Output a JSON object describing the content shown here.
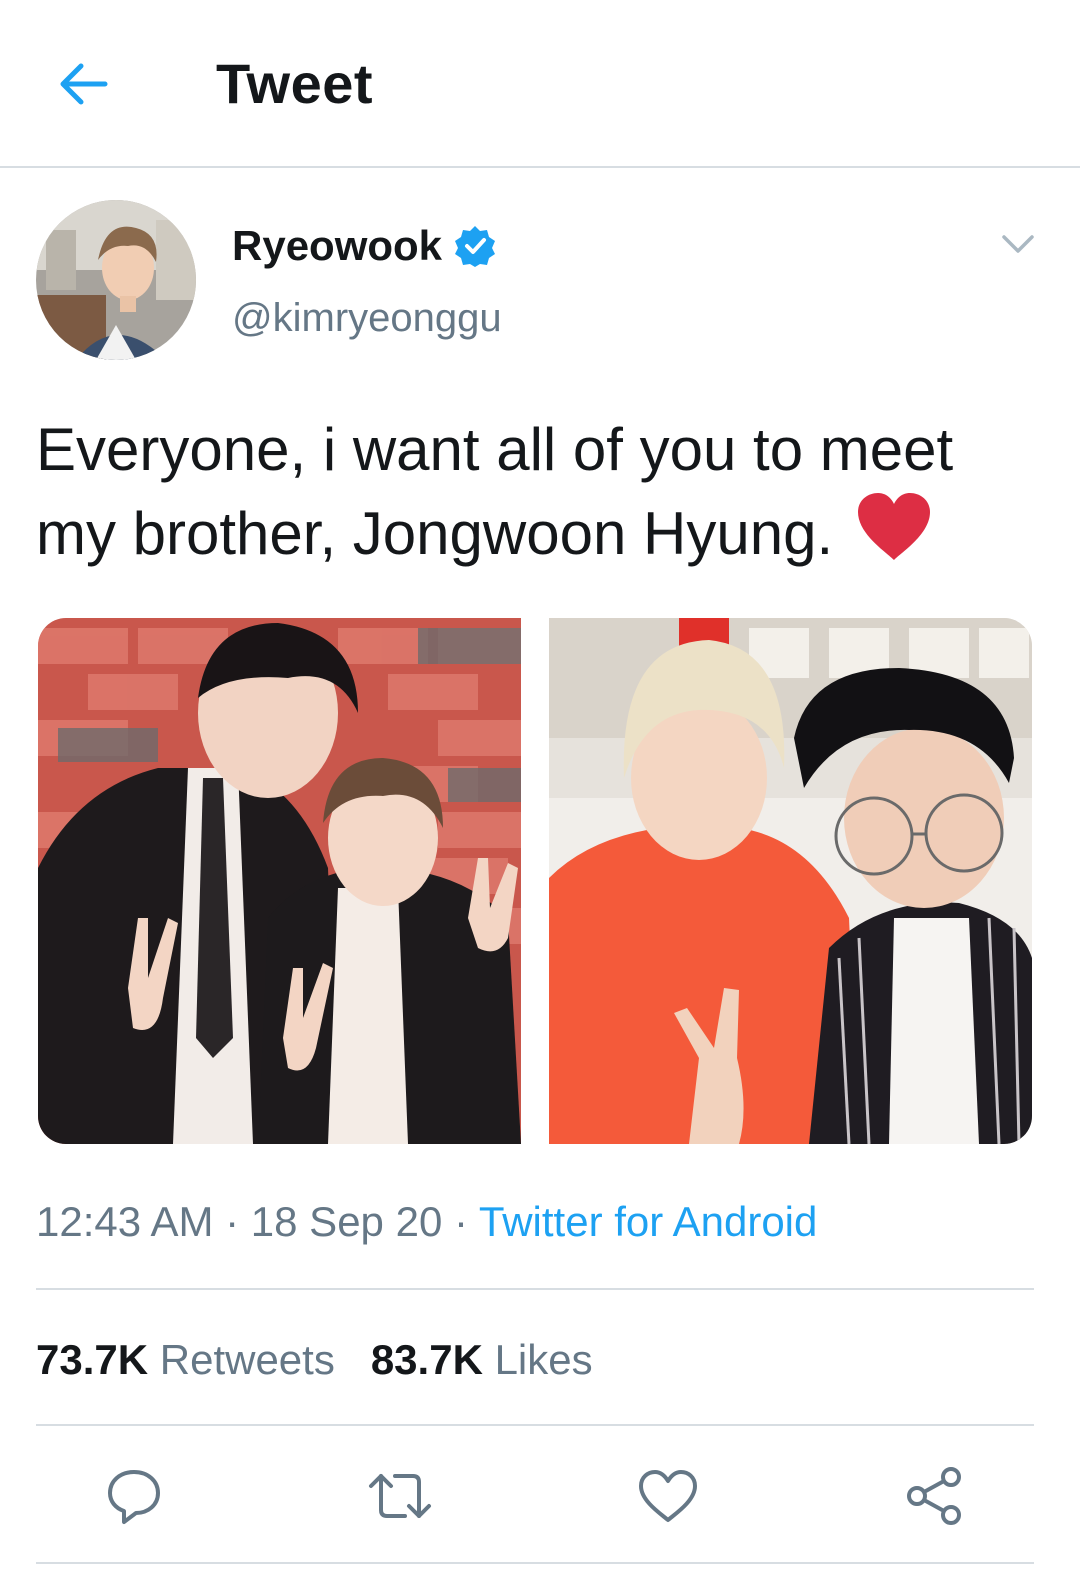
{
  "header": {
    "title": "Tweet",
    "back_icon": "arrow-left-icon"
  },
  "author": {
    "display_name": "Ryeowook",
    "handle": "@kimryeonggu",
    "verified": true
  },
  "tweet": {
    "text": "Everyone, i want all of you to meet my brother, Jongwoon Hyung.",
    "emoji": "heart-emoji",
    "media": [
      {
        "description": "photo-1"
      },
      {
        "description": "photo-2"
      }
    ]
  },
  "meta": {
    "time": "12:43 AM",
    "separator": " · ",
    "date": "18 Sep 20",
    "source": "Twitter for Android"
  },
  "stats": {
    "retweets_count": "73.7K",
    "retweets_label": "Retweets",
    "likes_count": "83.7K",
    "likes_label": "Likes"
  },
  "colors": {
    "accent": "#1da1f2",
    "text": "#14171a",
    "secondary": "#657786",
    "divider": "#d7dde2",
    "heart": "#dd2e44"
  }
}
